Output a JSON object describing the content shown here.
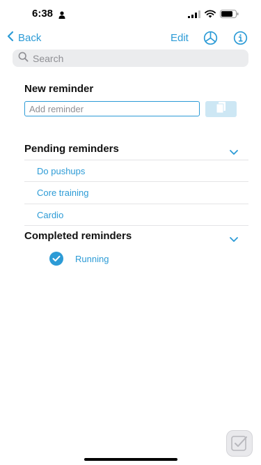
{
  "status_bar": {
    "time": "6:38"
  },
  "nav": {
    "back_label": "Back",
    "edit_label": "Edit"
  },
  "search": {
    "placeholder": "Search"
  },
  "new_reminder": {
    "title": "New reminder",
    "input_placeholder": "Add reminder"
  },
  "pending": {
    "title": "Pending reminders",
    "items": [
      {
        "label": "Do pushups"
      },
      {
        "label": "Core training"
      },
      {
        "label": "Cardio"
      }
    ]
  },
  "completed": {
    "title": "Completed reminders",
    "items": [
      {
        "label": "Running",
        "checked": true
      }
    ]
  },
  "colors": {
    "accent": "#2c9bd6",
    "search_bg": "#ebecee",
    "button_disabled_bg": "#cde7f4"
  },
  "icons": {
    "back": "chevron-left-icon",
    "pie": "pie-chart-icon",
    "info": "info-icon",
    "search": "search-icon",
    "paste": "paste-icon",
    "expand": "chevron-down-icon",
    "check": "checkmark-icon"
  }
}
